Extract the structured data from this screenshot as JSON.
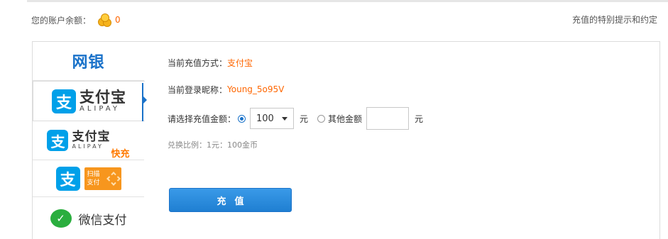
{
  "header": {
    "balance_label": "您的账户余额：",
    "balance_value": "0",
    "special_tips_link": "充值的特别提示和约定"
  },
  "sidebar": {
    "items": [
      {
        "id": "netbank",
        "label": "网银",
        "active": false
      },
      {
        "id": "alipay",
        "label_cn": "支付宝",
        "label_en": "ALIPAY",
        "icon": "支",
        "active": true
      },
      {
        "id": "alipay-fast",
        "label_cn": "支付宝",
        "label_en": "ALIPAY",
        "fast_label": "快充",
        "icon": "支",
        "active": false
      },
      {
        "id": "alipay-scan",
        "icon": "支",
        "badge_line1": "扫描",
        "badge_line2": "支付",
        "active": false
      },
      {
        "id": "wechat",
        "label": "微信支付",
        "icon": "✓",
        "active": false
      }
    ]
  },
  "form": {
    "method_label": "当前充值方式：",
    "method_value": "支付宝",
    "nick_label": "当前登录昵称：",
    "nick_value": "Young_5o95V",
    "amount_label": "请选择充值金额：",
    "amount_selected": "100",
    "amount_unit": "元",
    "other_amount_label": "其他金额",
    "other_amount_value": "",
    "other_amount_unit": "元",
    "ratio_text": "兑换比例：1元：100金币",
    "submit_label": "充值"
  },
  "colors": {
    "accent_blue": "#1a72c9",
    "button_blue": "#2e8fe1",
    "highlight_orange": "#ff6600",
    "alipay_blue": "#00a0e9",
    "wechat_green": "#2aae3e"
  }
}
